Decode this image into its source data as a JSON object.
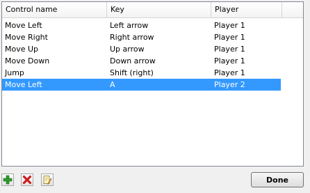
{
  "table": {
    "columns": [
      "Control name",
      "Key",
      "Player"
    ],
    "rows": [
      {
        "control": "Move Left",
        "key": "Left arrow",
        "player": "Player 1",
        "selected": false
      },
      {
        "control": "Move Right",
        "key": "Right arrow",
        "player": "Player 1",
        "selected": false
      },
      {
        "control": "Move Up",
        "key": "Up arrow",
        "player": "Player 1",
        "selected": false
      },
      {
        "control": "Move Down",
        "key": "Down arrow",
        "player": "Player 1",
        "selected": false
      },
      {
        "control": "Jump",
        "key": "Shift (right)",
        "player": "Player 1",
        "selected": false
      },
      {
        "control": "Move Left",
        "key": "A",
        "player": "Player 2",
        "selected": true
      }
    ]
  },
  "toolbar": {
    "add_icon": "plus-icon",
    "remove_icon": "delete-icon",
    "edit_icon": "edit-icon"
  },
  "buttons": {
    "done_label": "Done"
  },
  "colors": {
    "selection": "#3399ff",
    "add_green": "#2e9e2e",
    "remove_red": "#cc1f1f"
  }
}
